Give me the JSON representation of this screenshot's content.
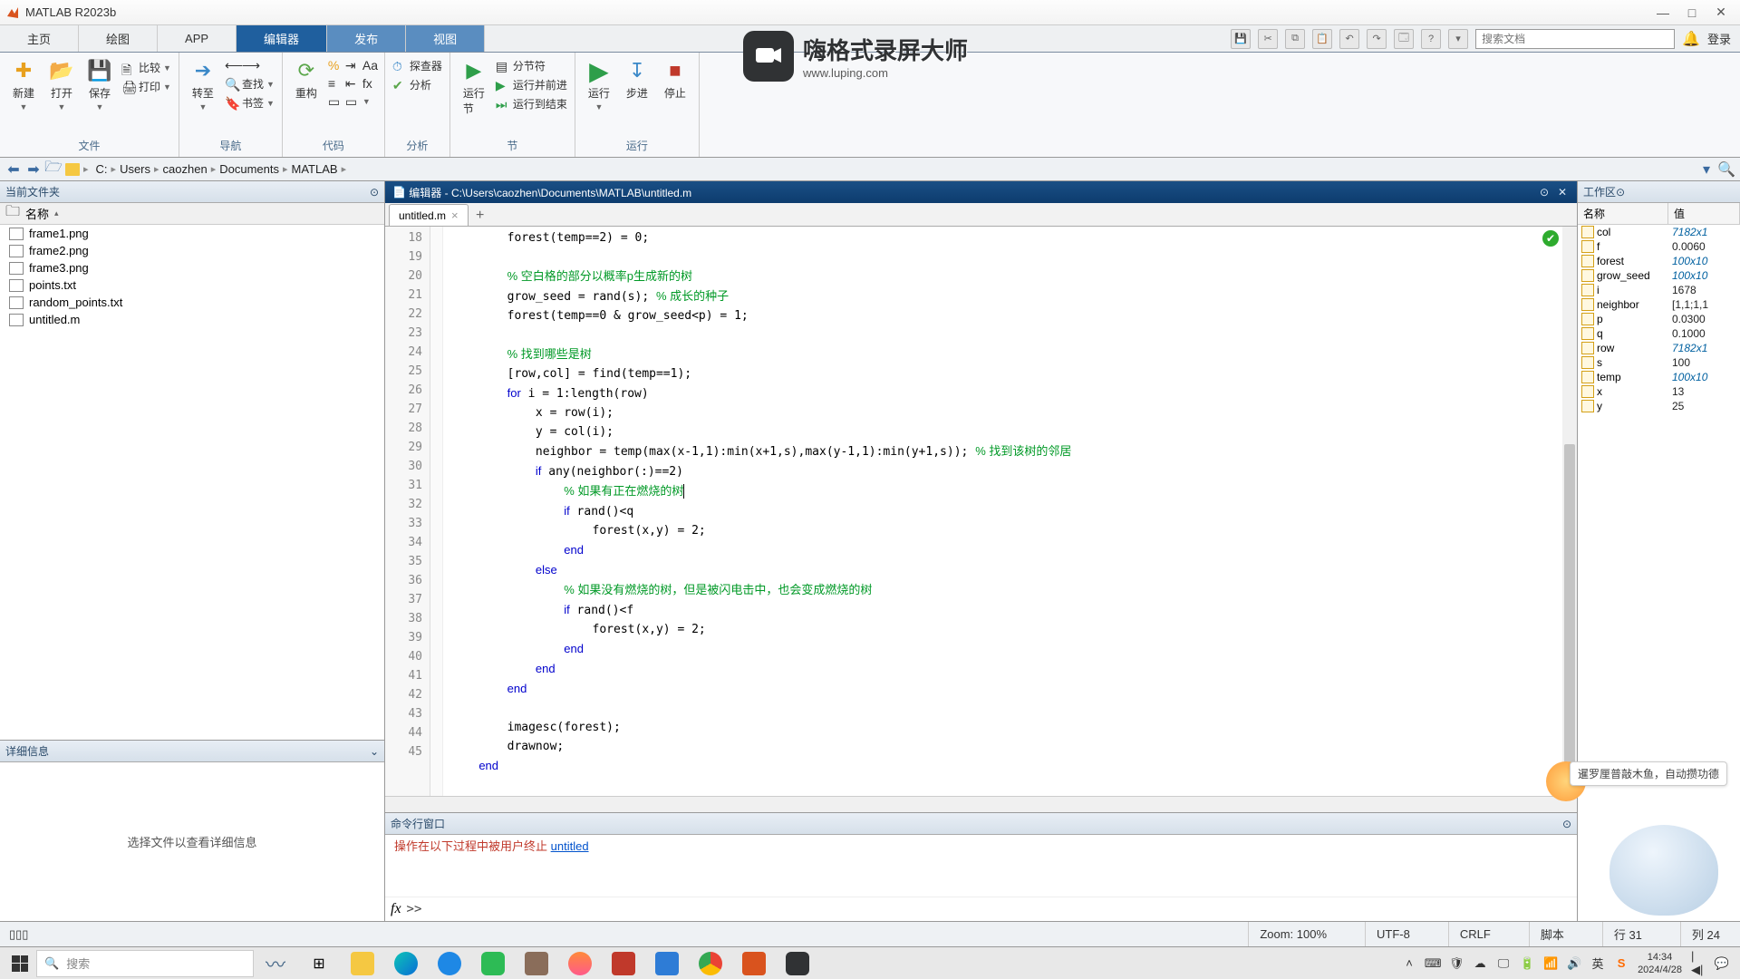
{
  "window": {
    "title": "MATLAB R2023b"
  },
  "tabs": {
    "items": [
      "主页",
      "绘图",
      "APP",
      "编辑器",
      "发布",
      "视图"
    ],
    "activeIndex": 3
  },
  "searchDocs": {
    "placeholder": "搜索文档"
  },
  "login": "登录",
  "ribbon": {
    "file": {
      "new": "新建",
      "open": "打开",
      "save": "保存",
      "compare": "比较",
      "print": "打印",
      "group": "文件"
    },
    "nav": {
      "goto": "转至",
      "find": "查找",
      "bookmark": "书签",
      "group": "导航"
    },
    "code": {
      "refactor": "重构",
      "group": "代码"
    },
    "analyze": {
      "inspector": "探查器",
      "analyze": "分析",
      "group": "分析"
    },
    "section": {
      "runsec": "运行\n节",
      "secbreak": "分节符",
      "runadv": "运行并前进",
      "runend": "运行到结束",
      "group": "节"
    },
    "run": {
      "run": "运行",
      "step": "步进",
      "stop": "停止",
      "group": "运行"
    }
  },
  "breadcrumbs": [
    "C:",
    "Users",
    "caozhen",
    "Documents",
    "MATLAB"
  ],
  "currentFolder": {
    "title": "当前文件夹",
    "nameCol": "名称",
    "files": [
      "frame1.png",
      "frame2.png",
      "frame3.png",
      "points.txt",
      "random_points.txt",
      "untitled.m"
    ]
  },
  "details": {
    "title": "详细信息",
    "placeholder": "选择文件以查看详细信息"
  },
  "editor": {
    "title": "编辑器 - C:\\Users\\caozhen\\Documents\\MATLAB\\untitled.m",
    "filetab": "untitled.m",
    "startLine": 18,
    "lines": [
      {
        "indent": 2,
        "tokens": [
          [
            "",
            "forest(temp==2) = 0;"
          ]
        ]
      },
      {
        "indent": 2,
        "tokens": []
      },
      {
        "indent": 2,
        "tokens": [
          [
            "cm",
            "% 空白格的部分以概率p生成新的树"
          ]
        ]
      },
      {
        "indent": 2,
        "tokens": [
          [
            "",
            "grow_seed = rand(s); "
          ],
          [
            "cm",
            "% 成长的种子"
          ]
        ]
      },
      {
        "indent": 2,
        "tokens": [
          [
            "",
            "forest(temp==0 & grow_seed<p) = 1;"
          ]
        ]
      },
      {
        "indent": 2,
        "tokens": []
      },
      {
        "indent": 2,
        "tokens": [
          [
            "cm",
            "% 找到哪些是树"
          ]
        ]
      },
      {
        "indent": 2,
        "tokens": [
          [
            "",
            "[row,col] = find(temp==1);"
          ]
        ]
      },
      {
        "indent": 2,
        "tokens": [
          [
            "kw",
            "for"
          ],
          [
            "",
            " i = 1:length(row)"
          ]
        ]
      },
      {
        "indent": 3,
        "tokens": [
          [
            "",
            "x = row(i);"
          ]
        ]
      },
      {
        "indent": 3,
        "tokens": [
          [
            "",
            "y = col(i);"
          ]
        ]
      },
      {
        "indent": 3,
        "tokens": [
          [
            "",
            "neighbor = temp(max(x-1,1):min(x+1,s),max(y-1,1):min(y+1,s)); "
          ],
          [
            "cm",
            "% 找到该树的邻居"
          ]
        ]
      },
      {
        "indent": 3,
        "tokens": [
          [
            "kw",
            "if"
          ],
          [
            "",
            " any(neighbor(:)==2)"
          ]
        ]
      },
      {
        "indent": 4,
        "tokens": [
          [
            "cm",
            "% 如果有正在燃烧的树"
          ]
        ],
        "caret": true
      },
      {
        "indent": 4,
        "tokens": [
          [
            "kw",
            "if"
          ],
          [
            "",
            " rand()<q"
          ]
        ]
      },
      {
        "indent": 5,
        "tokens": [
          [
            "",
            "forest(x,y) = 2;"
          ]
        ]
      },
      {
        "indent": 4,
        "tokens": [
          [
            "kw",
            "end"
          ]
        ]
      },
      {
        "indent": 3,
        "tokens": [
          [
            "kw",
            "else"
          ]
        ]
      },
      {
        "indent": 4,
        "tokens": [
          [
            "cm",
            "% 如果没有燃烧的树，但是被闪电击中，也会变成燃烧的树"
          ]
        ]
      },
      {
        "indent": 4,
        "tokens": [
          [
            "kw",
            "if"
          ],
          [
            "",
            " rand()<f"
          ]
        ]
      },
      {
        "indent": 5,
        "tokens": [
          [
            "",
            "forest(x,y) = 2;"
          ]
        ]
      },
      {
        "indent": 4,
        "tokens": [
          [
            "kw",
            "end"
          ]
        ]
      },
      {
        "indent": 3,
        "tokens": [
          [
            "kw",
            "end"
          ]
        ]
      },
      {
        "indent": 2,
        "tokens": [
          [
            "kw",
            "end"
          ]
        ]
      },
      {
        "indent": 2,
        "tokens": []
      },
      {
        "indent": 2,
        "tokens": [
          [
            "",
            "imagesc(forest);"
          ]
        ]
      },
      {
        "indent": 2,
        "tokens": [
          [
            "",
            "drawnow;"
          ]
        ]
      },
      {
        "indent": 1,
        "tokens": [
          [
            "kw",
            "end"
          ]
        ]
      }
    ]
  },
  "commandWindow": {
    "title": "命令行窗口",
    "errText": "操作在以下过程中被用户终止 ",
    "errLink": "untitled",
    "prompt": ">>"
  },
  "workspace": {
    "title": "工作区",
    "cols": {
      "name": "名称",
      "value": "值"
    },
    "vars": [
      {
        "name": "col",
        "value": "7182x1",
        "italic": true
      },
      {
        "name": "f",
        "value": "0.0060"
      },
      {
        "name": "forest",
        "value": "100x10",
        "italic": true
      },
      {
        "name": "grow_seed",
        "value": "100x10",
        "italic": true
      },
      {
        "name": "i",
        "value": "1678"
      },
      {
        "name": "neighbor",
        "value": "[1,1;1,1"
      },
      {
        "name": "p",
        "value": "0.0300"
      },
      {
        "name": "q",
        "value": "0.1000"
      },
      {
        "name": "row",
        "value": "7182x1",
        "italic": true
      },
      {
        "name": "s",
        "value": "100"
      },
      {
        "name": "temp",
        "value": "100x10",
        "italic": true
      },
      {
        "name": "x",
        "value": "13"
      },
      {
        "name": "y",
        "value": "25"
      }
    ]
  },
  "status": {
    "zoom": "Zoom: 100%",
    "encoding": "UTF-8",
    "eol": "CRLF",
    "type": "脚本",
    "line": "行 31",
    "col": "列 24"
  },
  "overlay": {
    "title": "嗨格式录屏大师",
    "sub": "www.luping.com"
  },
  "mascot": {
    "text": "暹罗厘普敲木鱼，自动攒功德"
  },
  "taskbar": {
    "searchPlaceholder": "搜索",
    "clock": {
      "time": "14:34",
      "date": "2024/4/28"
    }
  }
}
